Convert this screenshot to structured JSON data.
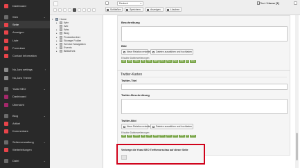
{
  "colors": {
    "sidebar_bg": "#292929",
    "accent_red": "#c8102e",
    "highlight_border": "#d0021b",
    "badge_green": "#79a548"
  },
  "sidebar": {
    "items": [
      {
        "label": "Dashboard",
        "icon": "dashboard-icon",
        "color": "#e8444a"
      },
      {
        "label": "Web",
        "icon": "web-icon",
        "color": "#6b6b6b",
        "chevron": "⌄"
      },
      {
        "label": "Seite",
        "icon": "page-icon",
        "color": "#e8444a",
        "active": true
      },
      {
        "label": "Anzeigen",
        "icon": "view-icon",
        "color": "#e8444a"
      },
      {
        "label": "Liste",
        "icon": "list-icon",
        "color": "#e8444a"
      },
      {
        "label": "Formulare",
        "icon": "forms-icon",
        "color": "#e8444a"
      },
      {
        "label": "Contact Information",
        "icon": "contact-icon",
        "color": "#e8444a"
      },
      {
        "label": "No,Jaro settings",
        "icon": "settings-icon",
        "color": "#8a8a8a",
        "chevron": "›"
      },
      {
        "label": "No,Jaro Theme",
        "icon": "theme-icon",
        "color": "#8a8a8a"
      },
      {
        "label": "Yoast SEO",
        "icon": "yoast-icon",
        "color": "#6b6b6b",
        "chevron": "⌄"
      },
      {
        "label": "Dashboard",
        "icon": "yoast-dashboard-icon",
        "color": "#a4286a"
      },
      {
        "label": "Übersicht",
        "icon": "overview-icon",
        "color": "#a4286a"
      },
      {
        "label": "Blog",
        "icon": "blog-icon",
        "color": "#6b6b6b",
        "chevron": "⌄"
      },
      {
        "label": "Artikel",
        "icon": "article-icon",
        "color": "#e8444a"
      },
      {
        "label": "Kommentare",
        "icon": "comments-icon",
        "color": "#e8444a"
      },
      {
        "label": "Seitenverwaltung",
        "icon": "site-management-icon",
        "color": "#6b6b6b",
        "chevron": "⌄"
      },
      {
        "label": "Weiterleitungen",
        "icon": "redirects-icon",
        "color": "#e8444a"
      },
      {
        "label": "Datei",
        "icon": "file-icon",
        "color": "#6b6b6b",
        "chevron": "⌄"
      }
    ]
  },
  "tree": {
    "items": [
      {
        "label": "Home",
        "level": 0,
        "arrow": "▾"
      },
      {
        "label": "Wer",
        "level": 1,
        "arrow": "▸"
      },
      {
        "label": "Wie",
        "level": 1,
        "arrow": ""
      },
      {
        "label": "Was",
        "level": 1,
        "arrow": "▸"
      },
      {
        "label": "Blog",
        "level": 1,
        "arrow": "▸"
      },
      {
        "label": "Produktordner",
        "level": 1,
        "arrow": "▸"
      },
      {
        "label": "Storage Folder",
        "level": 1,
        "arrow": "▸"
      },
      {
        "label": "Service Navigation",
        "level": 1,
        "arrow": "▸"
      },
      {
        "label": "Events",
        "level": 1,
        "arrow": "▸"
      },
      {
        "label": "Bibliothek",
        "level": 1,
        "arrow": "▸"
      }
    ]
  },
  "topbar": {
    "language": "Deutsch",
    "breadcrumb_prefix": "Pfad / ",
    "breadcrumb_page": "Home [1]",
    "buttons": [
      {
        "label": "Schließen",
        "icon": "close-icon"
      },
      {
        "label": "Speichern",
        "icon": "save-icon"
      },
      {
        "label": "Anzeigen",
        "icon": "preview-icon"
      },
      {
        "label": "Löschen",
        "icon": "delete-icon"
      }
    ]
  },
  "form": {
    "beschreibung_label": "Beschreibung",
    "bild_label": "Bild",
    "new_relation": "Neue Relation erstellen",
    "select_files": "Dateien auswählen und hochladen",
    "allowed_label": "Erlaubte Dateierweiterungen",
    "allowed_ext": [
      "GIF",
      "JPG",
      "JPEG",
      "TIF",
      "TIFF",
      "BMP",
      "PCX",
      "TGA",
      "PNG",
      "PDF",
      "AI",
      "SVG"
    ],
    "twitter_section": "Twitter-Karten",
    "twitter_title_label": "Twitter-Titel",
    "twitter_desc_label": "Twitter-Beschreibung",
    "twitter_image_label": "Twitter-Bild",
    "snippet_preview_label": "Verberge die Yoast SEO Trefforvorschau auf dieser Seite"
  }
}
